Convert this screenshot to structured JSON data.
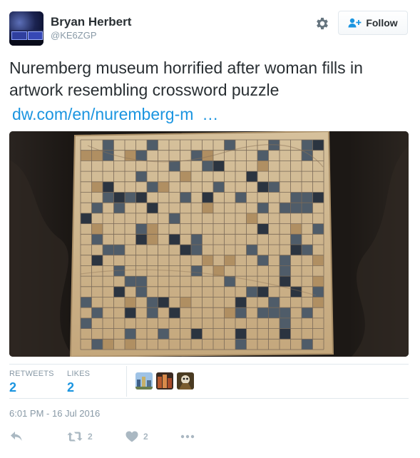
{
  "user": {
    "name": "Bryan Herbert",
    "handle": "@KE6ZGP"
  },
  "follow_button": {
    "label": "Follow"
  },
  "tweet": {
    "text": "Nuremberg museum horrified after woman fills in artwork resembling crossword puzzle",
    "link_text": "dw.com/en/nuremberg-m",
    "link_ellipsis": "…"
  },
  "stats": {
    "retweets_label": "RETWEETS",
    "retweets_value": "2",
    "likes_label": "LIKES",
    "likes_value": "2"
  },
  "timestamp": "6:01 PM - 16 Jul 2016",
  "actions": {
    "retweet_count": "2",
    "like_count": "2"
  },
  "colors": {
    "link": "#1b95e0",
    "muted": "#8899a6",
    "text": "#292f33",
    "icon": "#aab8c2"
  },
  "icons": {
    "settings": "gear-icon",
    "follow": "add-person-icon",
    "reply": "reply-icon",
    "retweet": "retweet-icon",
    "like": "heart-icon",
    "more": "more-dots-icon"
  }
}
